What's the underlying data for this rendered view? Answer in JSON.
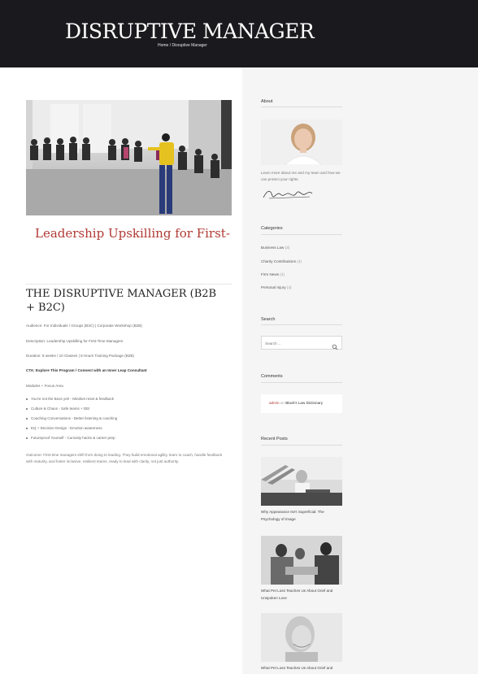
{
  "header": {
    "site_title": "DISRUPTIVE MANAGER",
    "breadcrumb_home": "Home",
    "breadcrumb_sep": " / ",
    "breadcrumb_current": "Disruptive Manager"
  },
  "hero": {
    "title": "Leadership Upskilling for First-"
  },
  "post": {
    "title": "THE DISRUPTIVE MANAGER (B2B + B2C)",
    "audience": "Audience: For Individuals / Groups (B2C) | Corporate Workshop (B2B)",
    "description": "Description: Leadership Upskilling for First-Time Managers",
    "duration": "Duration: 8 weeks / 10 Classes | 8 Hours Training Package (B2B)",
    "cta": "CTA: Explore This Program / Connect with an Inner Leap Consultant",
    "modules_label": "Modules + Focus Area",
    "modules": [
      "You're not the Boss yet! - Mindset reset & feedback",
      "Culture & Chaos - Safe teams + DEI",
      "Coaching Conversations - Better listening & coaching",
      "EQ + Decision Design - Emotion awareness",
      "Futureproof Yourself - Curiosity hacks & career prep"
    ],
    "outcome": "Outcome: First-time managers shift from doing to leading. They build emotional agility, learn to coach, handle feedback with maturity, and foster inclusive, resilient teams, ready to lead with clarity, not just authority."
  },
  "sidebar": {
    "about": {
      "title": "About",
      "text": "Learn more about me and my team and how we can protect your rights."
    },
    "categories": {
      "title": "Categories",
      "items": [
        {
          "label": "Business Law",
          "count": "(3)"
        },
        {
          "label": "Charity Contributions",
          "count": "(4)"
        },
        {
          "label": "Firm News",
          "count": "(4)"
        },
        {
          "label": "Personal Injury",
          "count": "(4)"
        }
      ]
    },
    "search": {
      "title": "Search",
      "placeholder": "Search ..."
    },
    "comments": {
      "title": "Comments",
      "author": "admin",
      "on": " on ",
      "post": "Black's Law Dictionary"
    },
    "recent_posts": {
      "title": "Recent Posts",
      "items": [
        {
          "title": "Why Appearance Isn't Superficial: The Psychology of Image"
        },
        {
          "title": "What Pet Loss Teaches Us About Grief and Unspoken Love"
        },
        {
          "title": "What Pet Loss Teaches Us About Grief and"
        }
      ]
    }
  },
  "colors": {
    "header_bg": "#1a1a1e",
    "accent": "#b03a34",
    "sidebar_bg": "#f5f5f5"
  }
}
